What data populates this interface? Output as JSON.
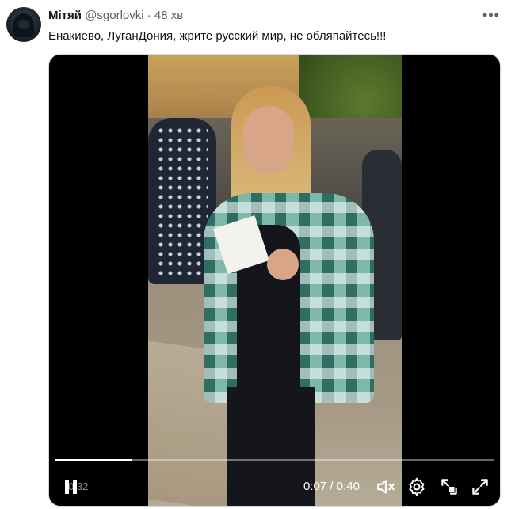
{
  "tweet": {
    "author_name": "Мітяй",
    "author_handle": "@sgorlovki",
    "separator": "·",
    "timestamp": "48 хв",
    "text": "Енакиево, ЛуганДония, жрите русский мир, не обляпайтесь!!!"
  },
  "video": {
    "overlay_duration": "0:32",
    "current_time": "0:07",
    "time_separator": " / ",
    "total_time": "0:40",
    "progress": 0.175
  },
  "icons": {
    "more": "more-icon",
    "pause": "pause-icon",
    "mute": "mute-icon",
    "settings": "gear-icon",
    "pip": "picture-in-picture-icon",
    "fullscreen": "fullscreen-icon"
  },
  "colors": {
    "text_primary": "#0f1419",
    "text_secondary": "#536471",
    "player_bg": "#000000"
  }
}
